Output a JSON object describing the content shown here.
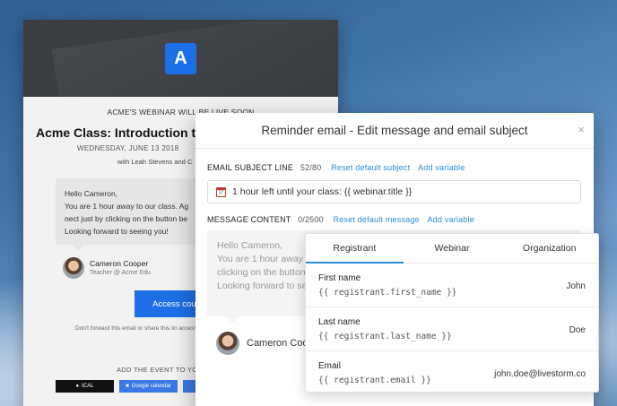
{
  "email_preview": {
    "logo_letter": "A",
    "live_soon": "ACME'S WEBINAR WILL BE LIVE SOON",
    "class_title": "Acme Class: Introduction to Co",
    "date": "WEDNESDAY, JUNE 13 2018",
    "with": "with Leah Stevens and C",
    "bubble_lines": [
      "Hello Cameron,",
      "You are 1 hour away to our class. Ag",
      "nect just by clicking on the button be",
      "Looking forward to seeing you!"
    ],
    "teacher_name": "Cameron Cooper",
    "teacher_role": "Teacher @ Acme Edu",
    "access_button": "Access cou",
    "forward_note": "Don't forward this email or share this lin access key to the webinar.",
    "add_event": "ADD THE EVENT TO YO",
    "cal_ical": "ICAL",
    "cal_google": "Google calendar"
  },
  "modal": {
    "title": "Reminder email - Edit message and email subject",
    "close": "×",
    "subject_label": "EMAIL SUBJECT LINE",
    "subject_count": "52/80",
    "subject_reset": "Reset default subject",
    "subject_add_var": "Add variable",
    "subject_value": "1 hour left until your class: {{ webinar.title }}",
    "subject_icon_text": "17",
    "message_label": "MESSAGE CONTENT",
    "message_count": "0/2500",
    "message_reset": "Reset default message",
    "message_add_var": "Add variable",
    "message_lines": [
      "Hello Cameron,",
      "You are 1 hour away",
      "clicking on the button",
      "Looking forward to se"
    ],
    "author_name": "Cameron Coo"
  },
  "variables": {
    "tabs": [
      "Registrant",
      "Webinar",
      "Organization"
    ],
    "active_tab": "Registrant",
    "rows": [
      {
        "name": "First name",
        "code": "{{ registrant.first_name }}",
        "value": "John"
      },
      {
        "name": "Last name",
        "code": "{{ registrant.last_name }}",
        "value": "Doe"
      },
      {
        "name": "Email",
        "code": "{{ registrant.email }}",
        "value": "john.doe@livestorm.co"
      }
    ]
  },
  "colors": {
    "accent": "#2a8bd6",
    "brand": "#1d6fe8"
  }
}
